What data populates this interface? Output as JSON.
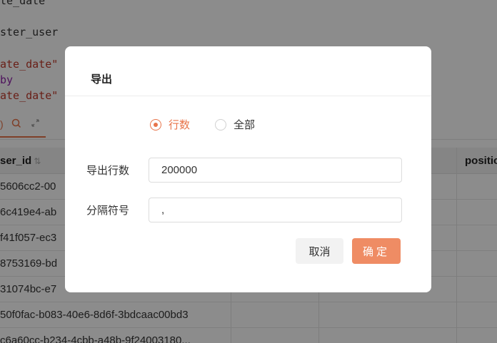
{
  "editor": {
    "lines": [
      {
        "text": "te_date",
        "style": "plain"
      },
      {
        "text": "ster_user",
        "style": "plain"
      },
      {
        "text": "ate_date\"",
        "style": "str"
      },
      {
        "text": "by",
        "style": "kw"
      },
      {
        "text": "ate_date\"",
        "style": "str"
      }
    ]
  },
  "grid": {
    "headers": [
      "ser_id",
      "positio"
    ],
    "rows": [
      "5606cc2-00",
      "6c419e4-ab",
      "f41f057-ec3",
      "8753169-bd",
      "31074bc-e7",
      "50f0fac-b083-40e6-8d6f-3bdcaac00bd3",
      "c6a60cc-b234-4cbb-a48b-9f24003180..."
    ]
  },
  "dialog": {
    "title": "导出",
    "radio_options": [
      "行数",
      "全部"
    ],
    "selected_option": "行数",
    "row_count_label": "导出行数",
    "row_count_value": "200000",
    "separator_label": "分隔符号",
    "separator_value": ",",
    "cancel_label": "取消",
    "ok_label": "确定"
  },
  "colors": {
    "accent": "#e8744a",
    "primary_button": "#ef8c64",
    "overlay": "rgba(0,0,0,0.45)"
  }
}
